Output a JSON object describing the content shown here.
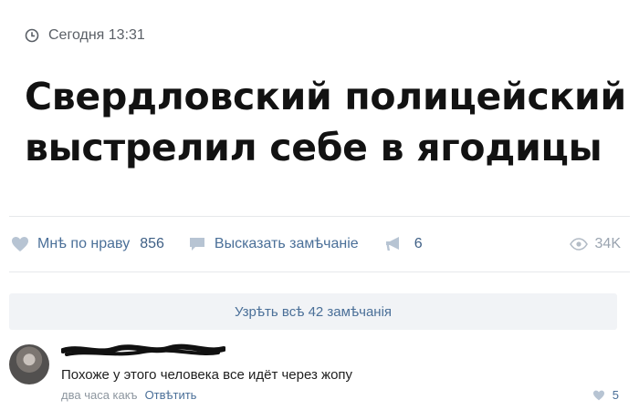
{
  "post": {
    "time": "Сегодня 13:31",
    "title": "Свердловский полицейский выстрелил себе в ягодицы"
  },
  "actions": {
    "like_label": "Мнѣ по нраву",
    "like_count": "856",
    "comment_label": "Высказать замѣчаніе",
    "share_count": "6",
    "views_count": "34K"
  },
  "comments": {
    "show_all_label": "Узрѣть всѣ 42 замѣчанія",
    "items": [
      {
        "text": "Похоже у этого человека все идёт через жопу",
        "time": "два часа какъ",
        "reply_label": "Отвѣтить",
        "likes": "5"
      }
    ]
  },
  "colors": {
    "accent": "#4a6f98",
    "muted": "#9aa4b0",
    "panel": "#f1f3f6"
  }
}
